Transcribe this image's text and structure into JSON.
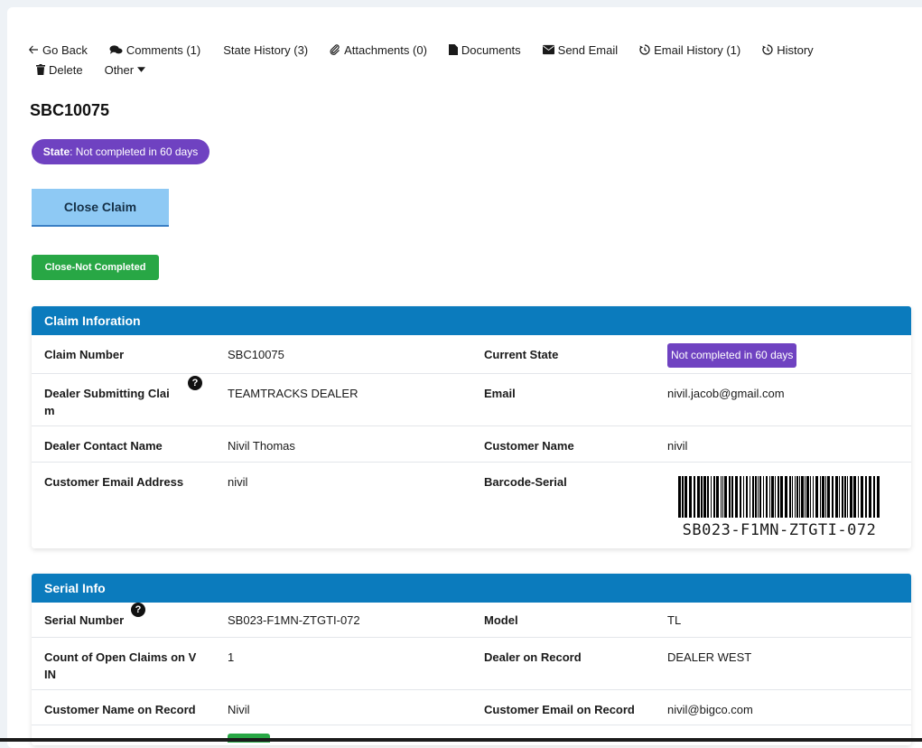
{
  "toolbar": {
    "go_back": "Go Back",
    "comments": "Comments (1)",
    "state_history": "State History (3)",
    "attachments": "Attachments (0)",
    "documents": "Documents",
    "send_email": "Send Email",
    "email_history": "Email History (1)",
    "history": "History",
    "delete": "Delete",
    "other": "Other"
  },
  "page_title": "SBC10075",
  "state_pill": {
    "label": "State",
    "value": ": Not completed in 60 days"
  },
  "buttons": {
    "close_claim": "Close Claim",
    "close_not_completed": "Close-Not Completed"
  },
  "claim_info": {
    "header": "Claim Inforation",
    "rows": [
      {
        "label1": "Claim Number",
        "value1": "SBC10075",
        "label2": "Current State",
        "value2": "Not completed in 60 days"
      },
      {
        "label1": "Dealer Submitting Clai\nm",
        "value1": "TEAMTRACKS DEALER",
        "label2": "Email",
        "value2": "nivil.jacob@gmail.com"
      },
      {
        "label1": "Dealer Contact Name",
        "value1": "Nivil Thomas",
        "label2": "Customer Name",
        "value2": "nivil"
      },
      {
        "label1": "Customer Email Address",
        "value1": "nivil",
        "label2": "Barcode-Serial",
        "value2": "SB023-F1MN-ZTGTI-072"
      }
    ]
  },
  "serial_info": {
    "header": "Serial Info",
    "rows": [
      {
        "label1": "Serial Number",
        "value1": "SB023-F1MN-ZTGTI-072",
        "label2": "Model",
        "value2": "TL"
      },
      {
        "label1": "Count of Open Claims on V\nIN",
        "value1": "1",
        "label2": "Dealer on Record",
        "value2": "DEALER WEST"
      },
      {
        "label1": "Customer Name on Record",
        "value1": "Nivil",
        "label2": "Customer Email on Record",
        "value2": "nivil@bigco.com"
      }
    ]
  },
  "help_icon_glyph": "?",
  "colors": {
    "primary": "#0b7bbd",
    "state": "#6f42c1",
    "success": "#28a745",
    "close_claim_bg": "#8ec9f4"
  }
}
